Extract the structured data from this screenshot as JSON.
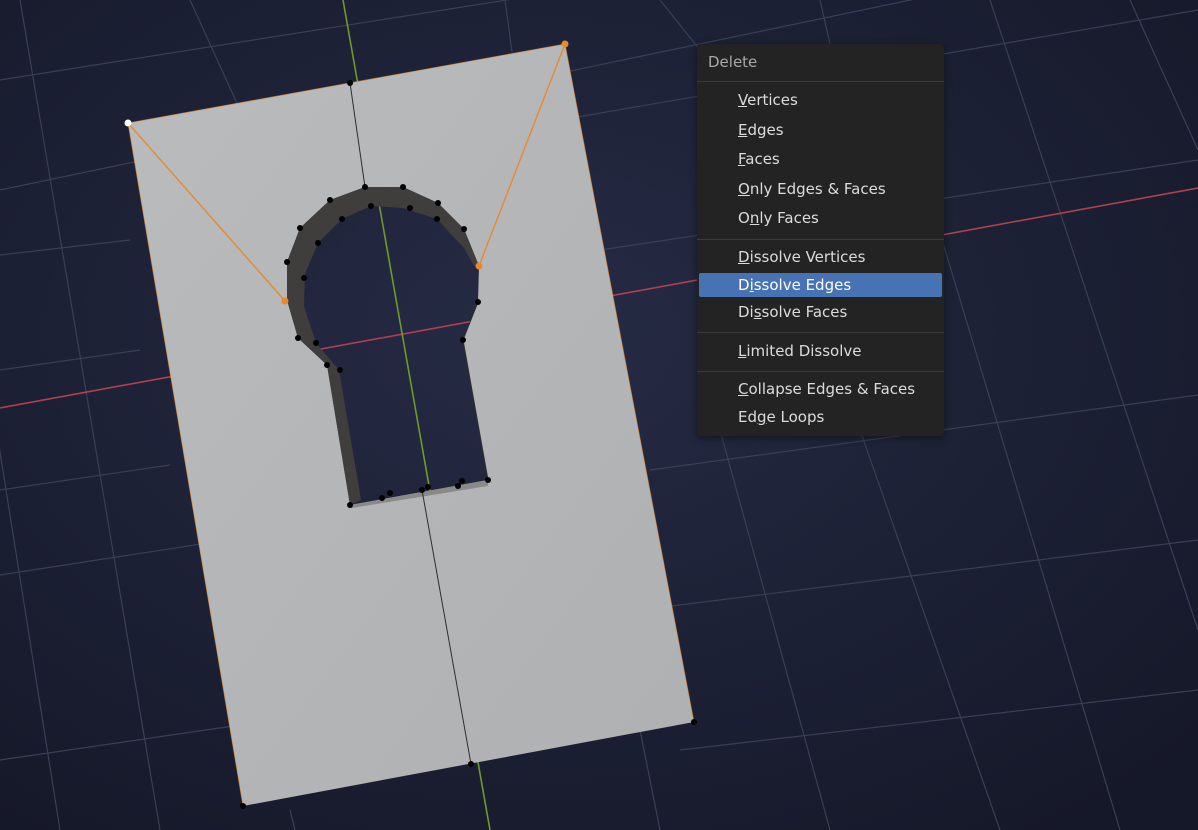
{
  "menu": {
    "title": "Delete",
    "active_item": "dissolve_edges",
    "items": {
      "vertices": {
        "label": "Vertices",
        "mnemonic": "V"
      },
      "edges": {
        "label": "Edges",
        "mnemonic": "E"
      },
      "faces": {
        "label": "Faces",
        "mnemonic": "F"
      },
      "only_edges_faces": {
        "label": "Only Edges & Faces",
        "mnemonic": "O"
      },
      "only_faces": {
        "label": "Only Faces",
        "mnemonic": "n"
      },
      "dissolve_vertices": {
        "label": "Dissolve Vertices",
        "mnemonic": "D"
      },
      "dissolve_edges": {
        "label": "Dissolve Edges",
        "mnemonic": "i"
      },
      "dissolve_faces": {
        "label": "Dissolve Faces",
        "mnemonic": "s"
      },
      "limited_dissolve": {
        "label": "Limited Dissolve",
        "mnemonic": "L"
      },
      "collapse_edges_faces": {
        "label": "Collapse Edges & Faces",
        "mnemonic": "C"
      },
      "edge_loops": {
        "label": "Edge Loops",
        "mnemonic": "g"
      }
    }
  },
  "colors": {
    "viewport_bg": "#1b1f33",
    "grid_line": "#3a3f52",
    "x_axis": "#b0404e",
    "y_axis": "#6e9a2a",
    "mesh_face": "#b4b6b8",
    "hole_wall": "#3c3b3a",
    "selected_edge": "#e8892b",
    "vertex": "#000000",
    "active_vertex": "#ffffff",
    "menu_bg": "#232323",
    "menu_highlight": "#4772b3"
  }
}
